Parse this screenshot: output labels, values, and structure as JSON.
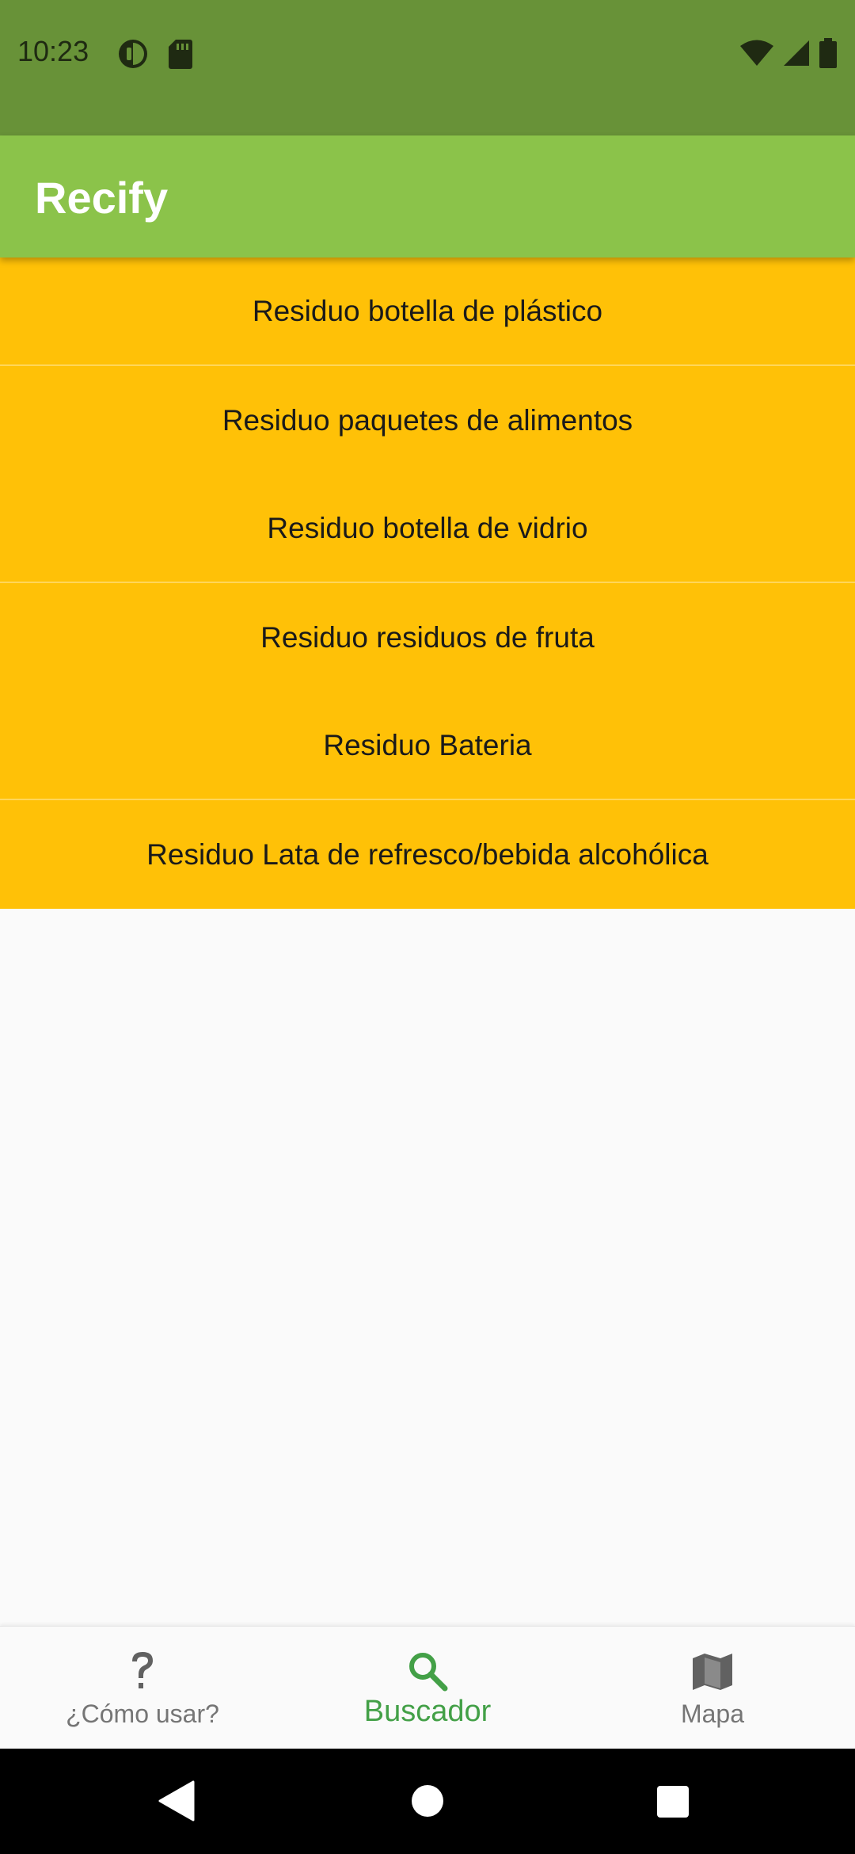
{
  "status_bar": {
    "time": "10:23",
    "icons": [
      "data-saver-icon",
      "sd-card-icon",
      "wifi-icon",
      "signal-icon",
      "battery-icon"
    ]
  },
  "app_bar": {
    "title": "Recify"
  },
  "waste_list": {
    "items": [
      "Residuo botella de plástico",
      "Residuo paquetes de alimentos",
      "Residuo botella de vidrio",
      "Residuo residuos de fruta",
      "Residuo Bateria",
      "Residuo Lata de refresco/bebida alcohólica"
    ]
  },
  "bottom_nav": {
    "items": [
      {
        "label": "¿Cómo usar?",
        "icon": "help-question-icon",
        "active": false
      },
      {
        "label": "Buscador",
        "icon": "search-icon",
        "active": true
      },
      {
        "label": "Mapa",
        "icon": "map-icon",
        "active": false
      }
    ]
  },
  "system_nav": {
    "buttons": [
      "back-icon",
      "home-icon",
      "recents-icon"
    ]
  },
  "colors": {
    "status_bar": "#689238",
    "app_bar": "#8BC34A",
    "list_item": "#FFC107",
    "nav_active": "#43A047",
    "nav_inactive": "#757575"
  }
}
